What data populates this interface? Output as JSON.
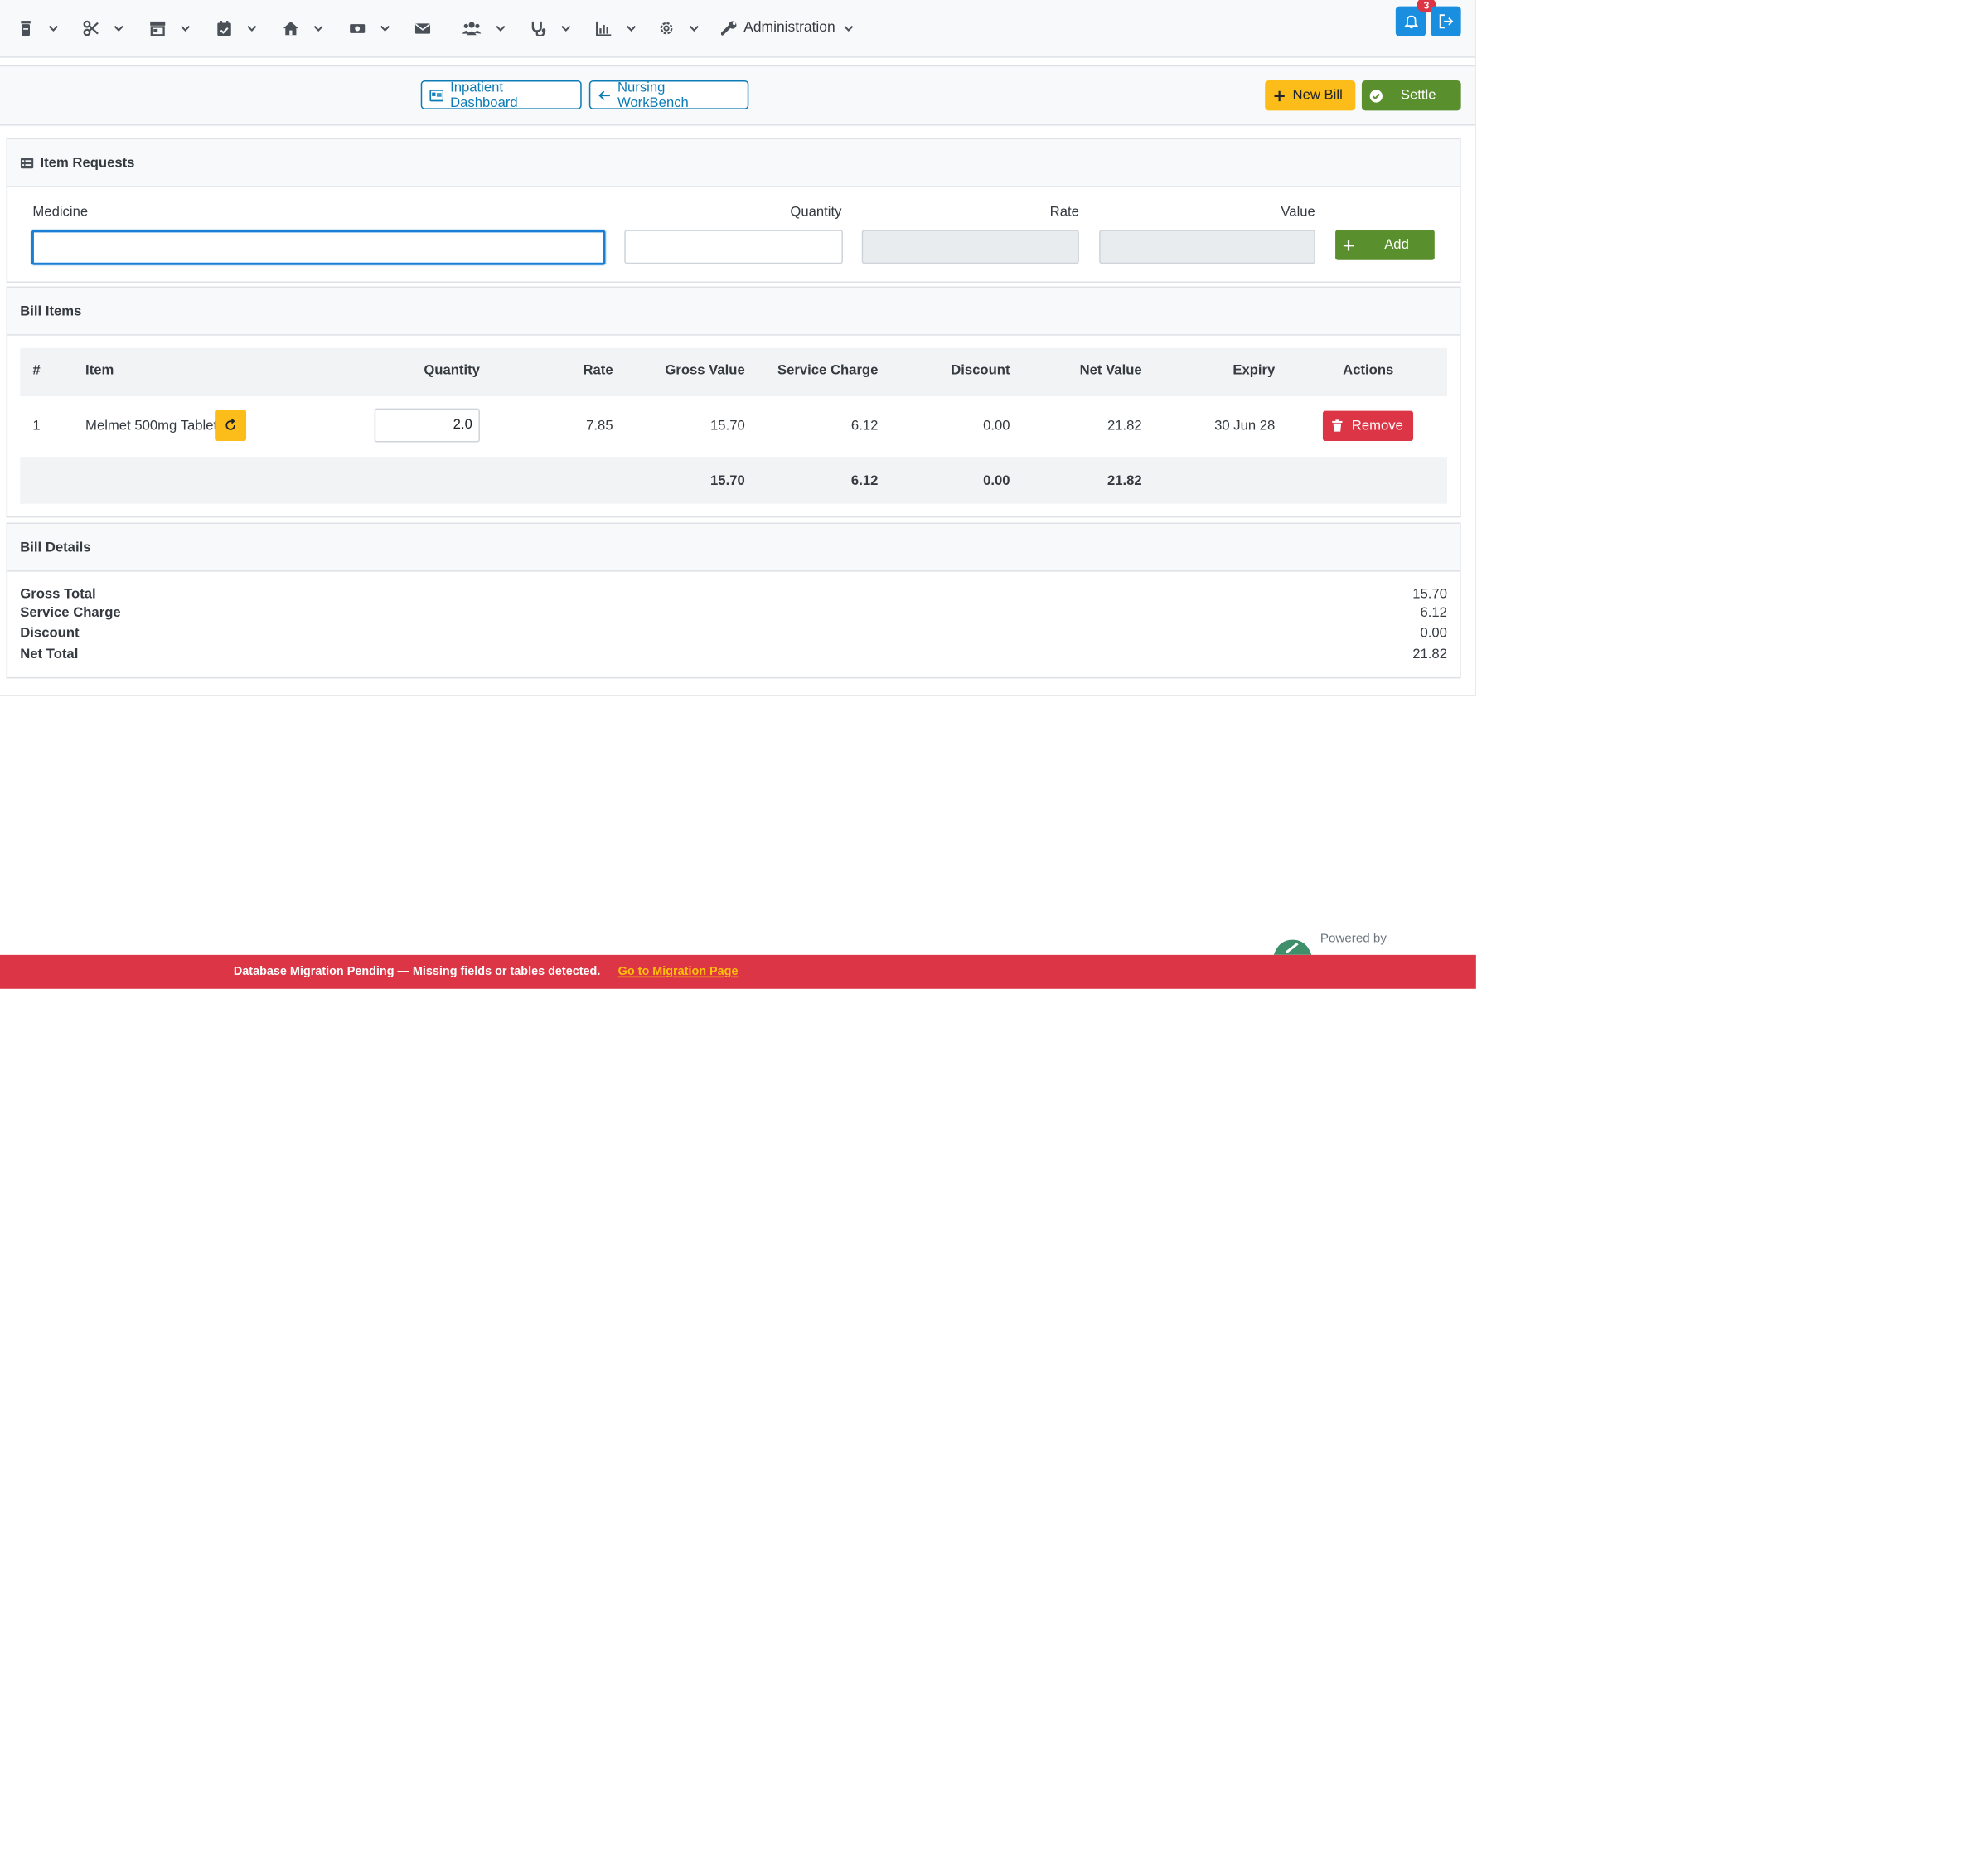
{
  "nav": {
    "administration_label": "Administration",
    "notification_count": "3"
  },
  "toolbar": {
    "inpatient_dashboard": "Inpatient Dashboard",
    "nursing_workbench": "Nursing WorkBench",
    "new_bill": "New Bill",
    "settle": "Settle"
  },
  "item_requests": {
    "title": "Item Requests",
    "medicine_label": "Medicine",
    "quantity_label": "Quantity",
    "rate_label": "Rate",
    "value_label": "Value",
    "add_label": "Add"
  },
  "bill_items": {
    "title": "Bill Items",
    "columns": [
      "#",
      "Item",
      "Quantity",
      "Rate",
      "Gross Value",
      "Service Charge",
      "Discount",
      "Net Value",
      "Expiry",
      "Actions"
    ],
    "rows": [
      {
        "index": "1",
        "item": "Melmet 500mg Tablet",
        "quantity": "2.0",
        "rate": "7.85",
        "gross_value": "15.70",
        "service_charge": "6.12",
        "discount": "0.00",
        "net_value": "21.82",
        "expiry": "30 Jun 28",
        "remove_label": "Remove"
      }
    ],
    "totals": {
      "gross_value": "15.70",
      "service_charge": "6.12",
      "discount": "0.00",
      "net_value": "21.82"
    }
  },
  "bill_details": {
    "title": "Bill Details",
    "rows": [
      {
        "label": "Gross Total",
        "value": "15.70"
      },
      {
        "label": "Service Charge",
        "value": "6.12"
      },
      {
        "label": "Discount",
        "value": "0.00"
      },
      {
        "label": "Net Total",
        "value": "21.82"
      }
    ]
  },
  "footer": {
    "powered_by": "Powered by",
    "migration_message": "Database Migration Pending — Missing fields or tables detected.",
    "migration_link": "Go to Migration Page"
  },
  "colors": {
    "primary": "#1a8fe0",
    "warning": "#fcbc1a",
    "success": "#5a8f2e",
    "danger": "#dc3545",
    "link": "#0d7bb5"
  }
}
